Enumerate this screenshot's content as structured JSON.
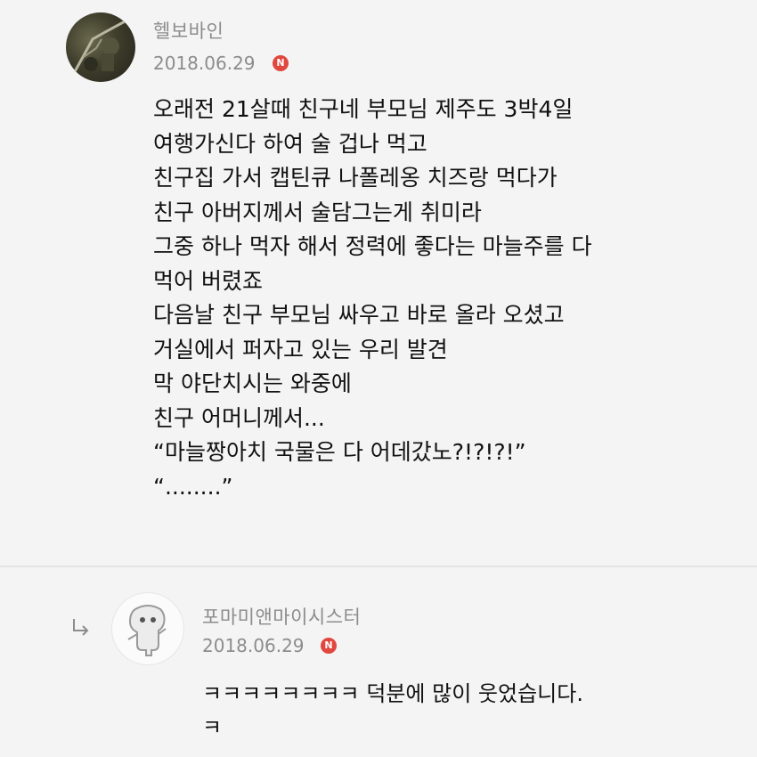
{
  "comment": {
    "author": "헬보바인",
    "date": "2018.06.29",
    "new_badge": "N",
    "lines": [
      "오래전 21살때 친구네 부모님 제주도 3박4일",
      "여행가신다 하여 술 겁나 먹고",
      "친구집 가서 캡틴큐 나폴레옹 치즈랑 먹다가",
      "친구 아버지께서 술담그는게 취미라",
      "그중 하나 먹자 해서 정력에 좋다는 마늘주를 다",
      "먹어 버렸죠",
      "다음날 친구 부모님 싸우고 바로 올라 오셨고",
      "거실에서 퍼자고 있는 우리 발견",
      "막 야단치시는 와중에",
      "친구 어머니께서...",
      "“마늘짱아치 국물은 다 어데갔노?!?!?!”",
      "“........”"
    ]
  },
  "reply": {
    "author": "포마미앤마이시스터",
    "date": "2018.06.29",
    "new_badge": "N",
    "lines": [
      "ㅋㅋㅋㅋㅋㅋㅋㅋ 덕분에 많이 웃었습니다.",
      "ㅋ"
    ]
  },
  "colors": {
    "background": "#f4f4f4",
    "meta_text": "#8c8c8c",
    "badge": "#e0473f"
  },
  "icons": {
    "reply_indicator": "reply-arrow-icon",
    "new_badge": "new-badge-icon"
  }
}
